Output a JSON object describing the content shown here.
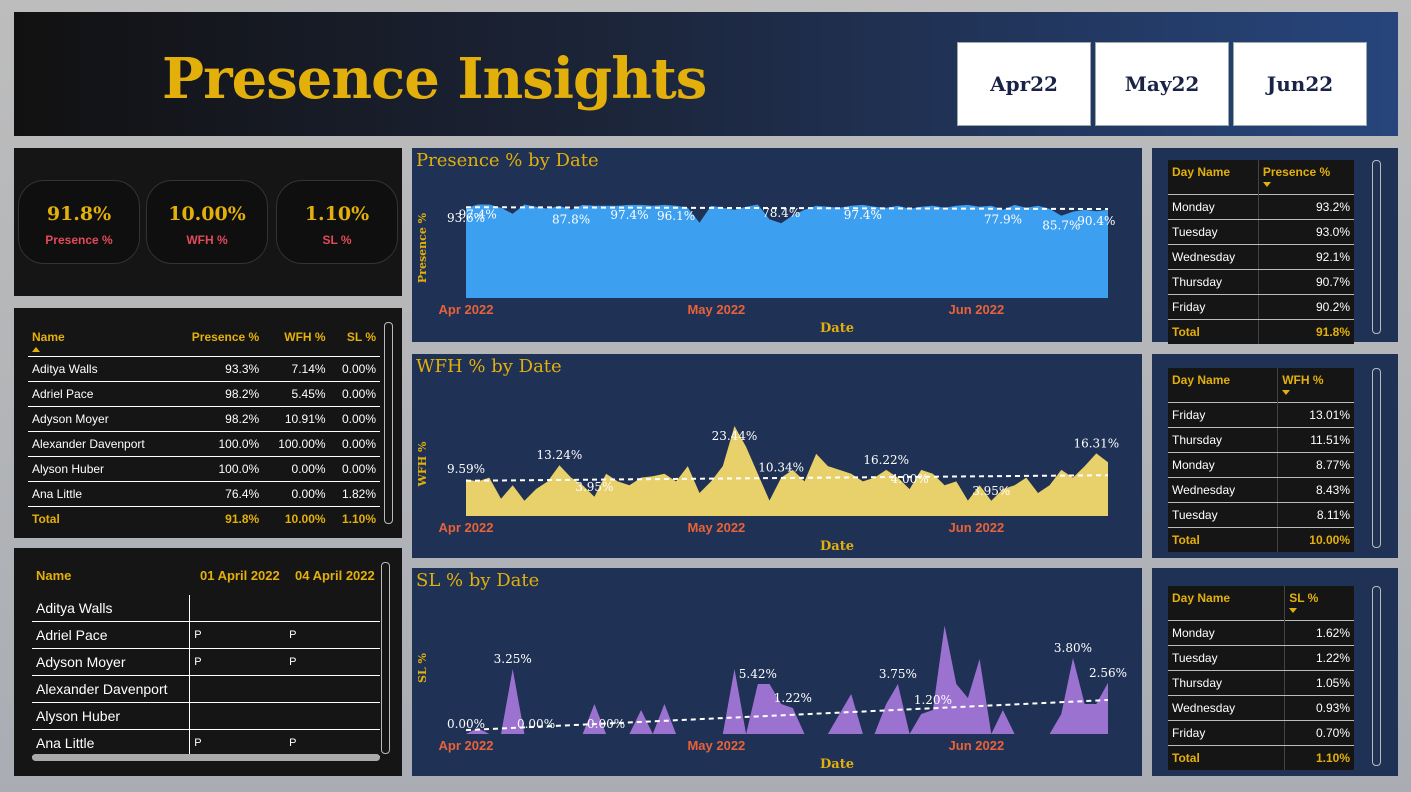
{
  "title": "Presence Insights",
  "months": [
    "Apr22",
    "May22",
    "Jun22"
  ],
  "kpis": [
    {
      "value": "91.8%",
      "label": "Presence %"
    },
    {
      "value": "10.00%",
      "label": "WFH %"
    },
    {
      "value": "1.10%",
      "label": "SL %"
    }
  ],
  "employee_table": {
    "headers": [
      "Name",
      "Presence %",
      "WFH %",
      "SL %"
    ],
    "rows": [
      [
        "Aditya Walls",
        "93.3%",
        "7.14%",
        "0.00%"
      ],
      [
        "Adriel Pace",
        "98.2%",
        "5.45%",
        "0.00%"
      ],
      [
        "Adyson Moyer",
        "98.2%",
        "10.91%",
        "0.00%"
      ],
      [
        "Alexander Davenport",
        "100.0%",
        "100.00%",
        "0.00%"
      ],
      [
        "Alyson Huber",
        "100.0%",
        "0.00%",
        "0.00%"
      ],
      [
        "Ana Little",
        "76.4%",
        "0.00%",
        "1.82%"
      ]
    ],
    "total": [
      "Total",
      "91.8%",
      "10.00%",
      "1.10%"
    ]
  },
  "attendance_grid": {
    "headers": [
      "Name",
      "01 April 2022",
      "04 April 2022"
    ],
    "rows": [
      [
        "Aditya Walls",
        "",
        ""
      ],
      [
        "Adriel Pace",
        "P",
        "P"
      ],
      [
        "Adyson Moyer",
        "P",
        "P"
      ],
      [
        "Alexander Davenport",
        "",
        ""
      ],
      [
        "Alyson Huber",
        "",
        ""
      ],
      [
        "Ana Little",
        "P",
        "P"
      ]
    ]
  },
  "day_tables": [
    {
      "headers": [
        "Day Name",
        "Presence %"
      ],
      "rows": [
        [
          "Monday",
          "93.2%"
        ],
        [
          "Tuesday",
          "93.0%"
        ],
        [
          "Wednesday",
          "92.1%"
        ],
        [
          "Thursday",
          "90.7%"
        ],
        [
          "Friday",
          "90.2%"
        ]
      ],
      "total": [
        "Total",
        "91.8%"
      ]
    },
    {
      "headers": [
        "Day Name",
        "WFH %"
      ],
      "rows": [
        [
          "Friday",
          "13.01%"
        ],
        [
          "Thursday",
          "11.51%"
        ],
        [
          "Monday",
          "8.77%"
        ],
        [
          "Wednesday",
          "8.43%"
        ],
        [
          "Tuesday",
          "8.11%"
        ]
      ],
      "total": [
        "Total",
        "10.00%"
      ]
    },
    {
      "headers": [
        "Day Name",
        "SL %"
      ],
      "rows": [
        [
          "Monday",
          "1.62%"
        ],
        [
          "Tuesday",
          "1.22%"
        ],
        [
          "Thursday",
          "1.05%"
        ],
        [
          "Wednesday",
          "0.93%"
        ],
        [
          "Friday",
          "0.70%"
        ]
      ],
      "total": [
        "Total",
        "1.10%"
      ]
    }
  ],
  "colors": {
    "gold": "#e3b00b",
    "presence": "#3d9ff0",
    "wfh": "#e8d06a",
    "sl": "#9b72d0",
    "axis_tick": "#e8623a"
  },
  "chart_data": [
    {
      "type": "area",
      "title": "Presence % by Date",
      "xlabel": "Date",
      "ylabel": "Presence %",
      "x_ticks": [
        "Apr 2022",
        "May 2022",
        "Jun 2022"
      ],
      "ylim": [
        0,
        100
      ],
      "trendline": true,
      "values": [
        93.6,
        97.4,
        97.4,
        94,
        87.8,
        97.4,
        95,
        93,
        96,
        92,
        97,
        96,
        96,
        96,
        97,
        97,
        96.1,
        97,
        96,
        94,
        78.4,
        96,
        94,
        92,
        95,
        97.4,
        82,
        77.9,
        86,
        92,
        96,
        95,
        94,
        96,
        97,
        95,
        94,
        96,
        93,
        95,
        96,
        94,
        96,
        97,
        95,
        96,
        92,
        97,
        94,
        96,
        93,
        85.7,
        90,
        92,
        90.4,
        92
      ],
      "labels": [
        "93.6%",
        "97.4%",
        "87.8%",
        "97.4%",
        "96.1%",
        "78.4%",
        "97.4%",
        "77.9%",
        "85.7%",
        "90.4%"
      ]
    },
    {
      "type": "area",
      "title": "WFH % by Date",
      "xlabel": "Date",
      "ylabel": "WFH %",
      "x_ticks": [
        "Apr 2022",
        "May 2022",
        "Jun 2022"
      ],
      "ylim": [
        0,
        25
      ],
      "trendline": true,
      "values": [
        9.59,
        9,
        10,
        4.5,
        8,
        3.95,
        7,
        9,
        13.24,
        10,
        8,
        5,
        11,
        9,
        8,
        10,
        10.34,
        11,
        9,
        13,
        6,
        9,
        13,
        23.44,
        18,
        11,
        4.0,
        10,
        12,
        9,
        16.22,
        13,
        12,
        11,
        9,
        10,
        12,
        10,
        7,
        12,
        11,
        8,
        9,
        4,
        8,
        3.95,
        7,
        8,
        10,
        6,
        8,
        12,
        10,
        13,
        16.31,
        14
      ],
      "labels": [
        "9.59%",
        "13.24%",
        "3.95%",
        "23.44%",
        "10.34%",
        "4.00%",
        "16.22%",
        "3.95%",
        "16.31%"
      ]
    },
    {
      "type": "area",
      "title": "SL % by Date",
      "xlabel": "Date",
      "ylabel": "SL %",
      "x_ticks": [
        "Apr 2022",
        "May 2022",
        "Jun 2022"
      ],
      "ylim": [
        0,
        6
      ],
      "trendline": true,
      "values": [
        0,
        0.3,
        0,
        0,
        3.25,
        0,
        0,
        0,
        0,
        0,
        0,
        1.5,
        0,
        0,
        0,
        1.2,
        0,
        1.5,
        0,
        0,
        0,
        0,
        0,
        3.25,
        0,
        2.5,
        2.5,
        1.5,
        1.3,
        0,
        0,
        0,
        1.0,
        2.0,
        0,
        0,
        1.5,
        2.5,
        0,
        1.0,
        1.2,
        5.42,
        2.5,
        1.8,
        3.75,
        0,
        1.2,
        0,
        0,
        0,
        0,
        1.0,
        3.8,
        1.5,
        1.5,
        2.56
      ],
      "labels": [
        "0.00%",
        "3.25%",
        "0.00%",
        "0.00%",
        "1.22%",
        "5.42%",
        "3.75%",
        "1.20%",
        "3.80%",
        "2.56%"
      ]
    }
  ]
}
